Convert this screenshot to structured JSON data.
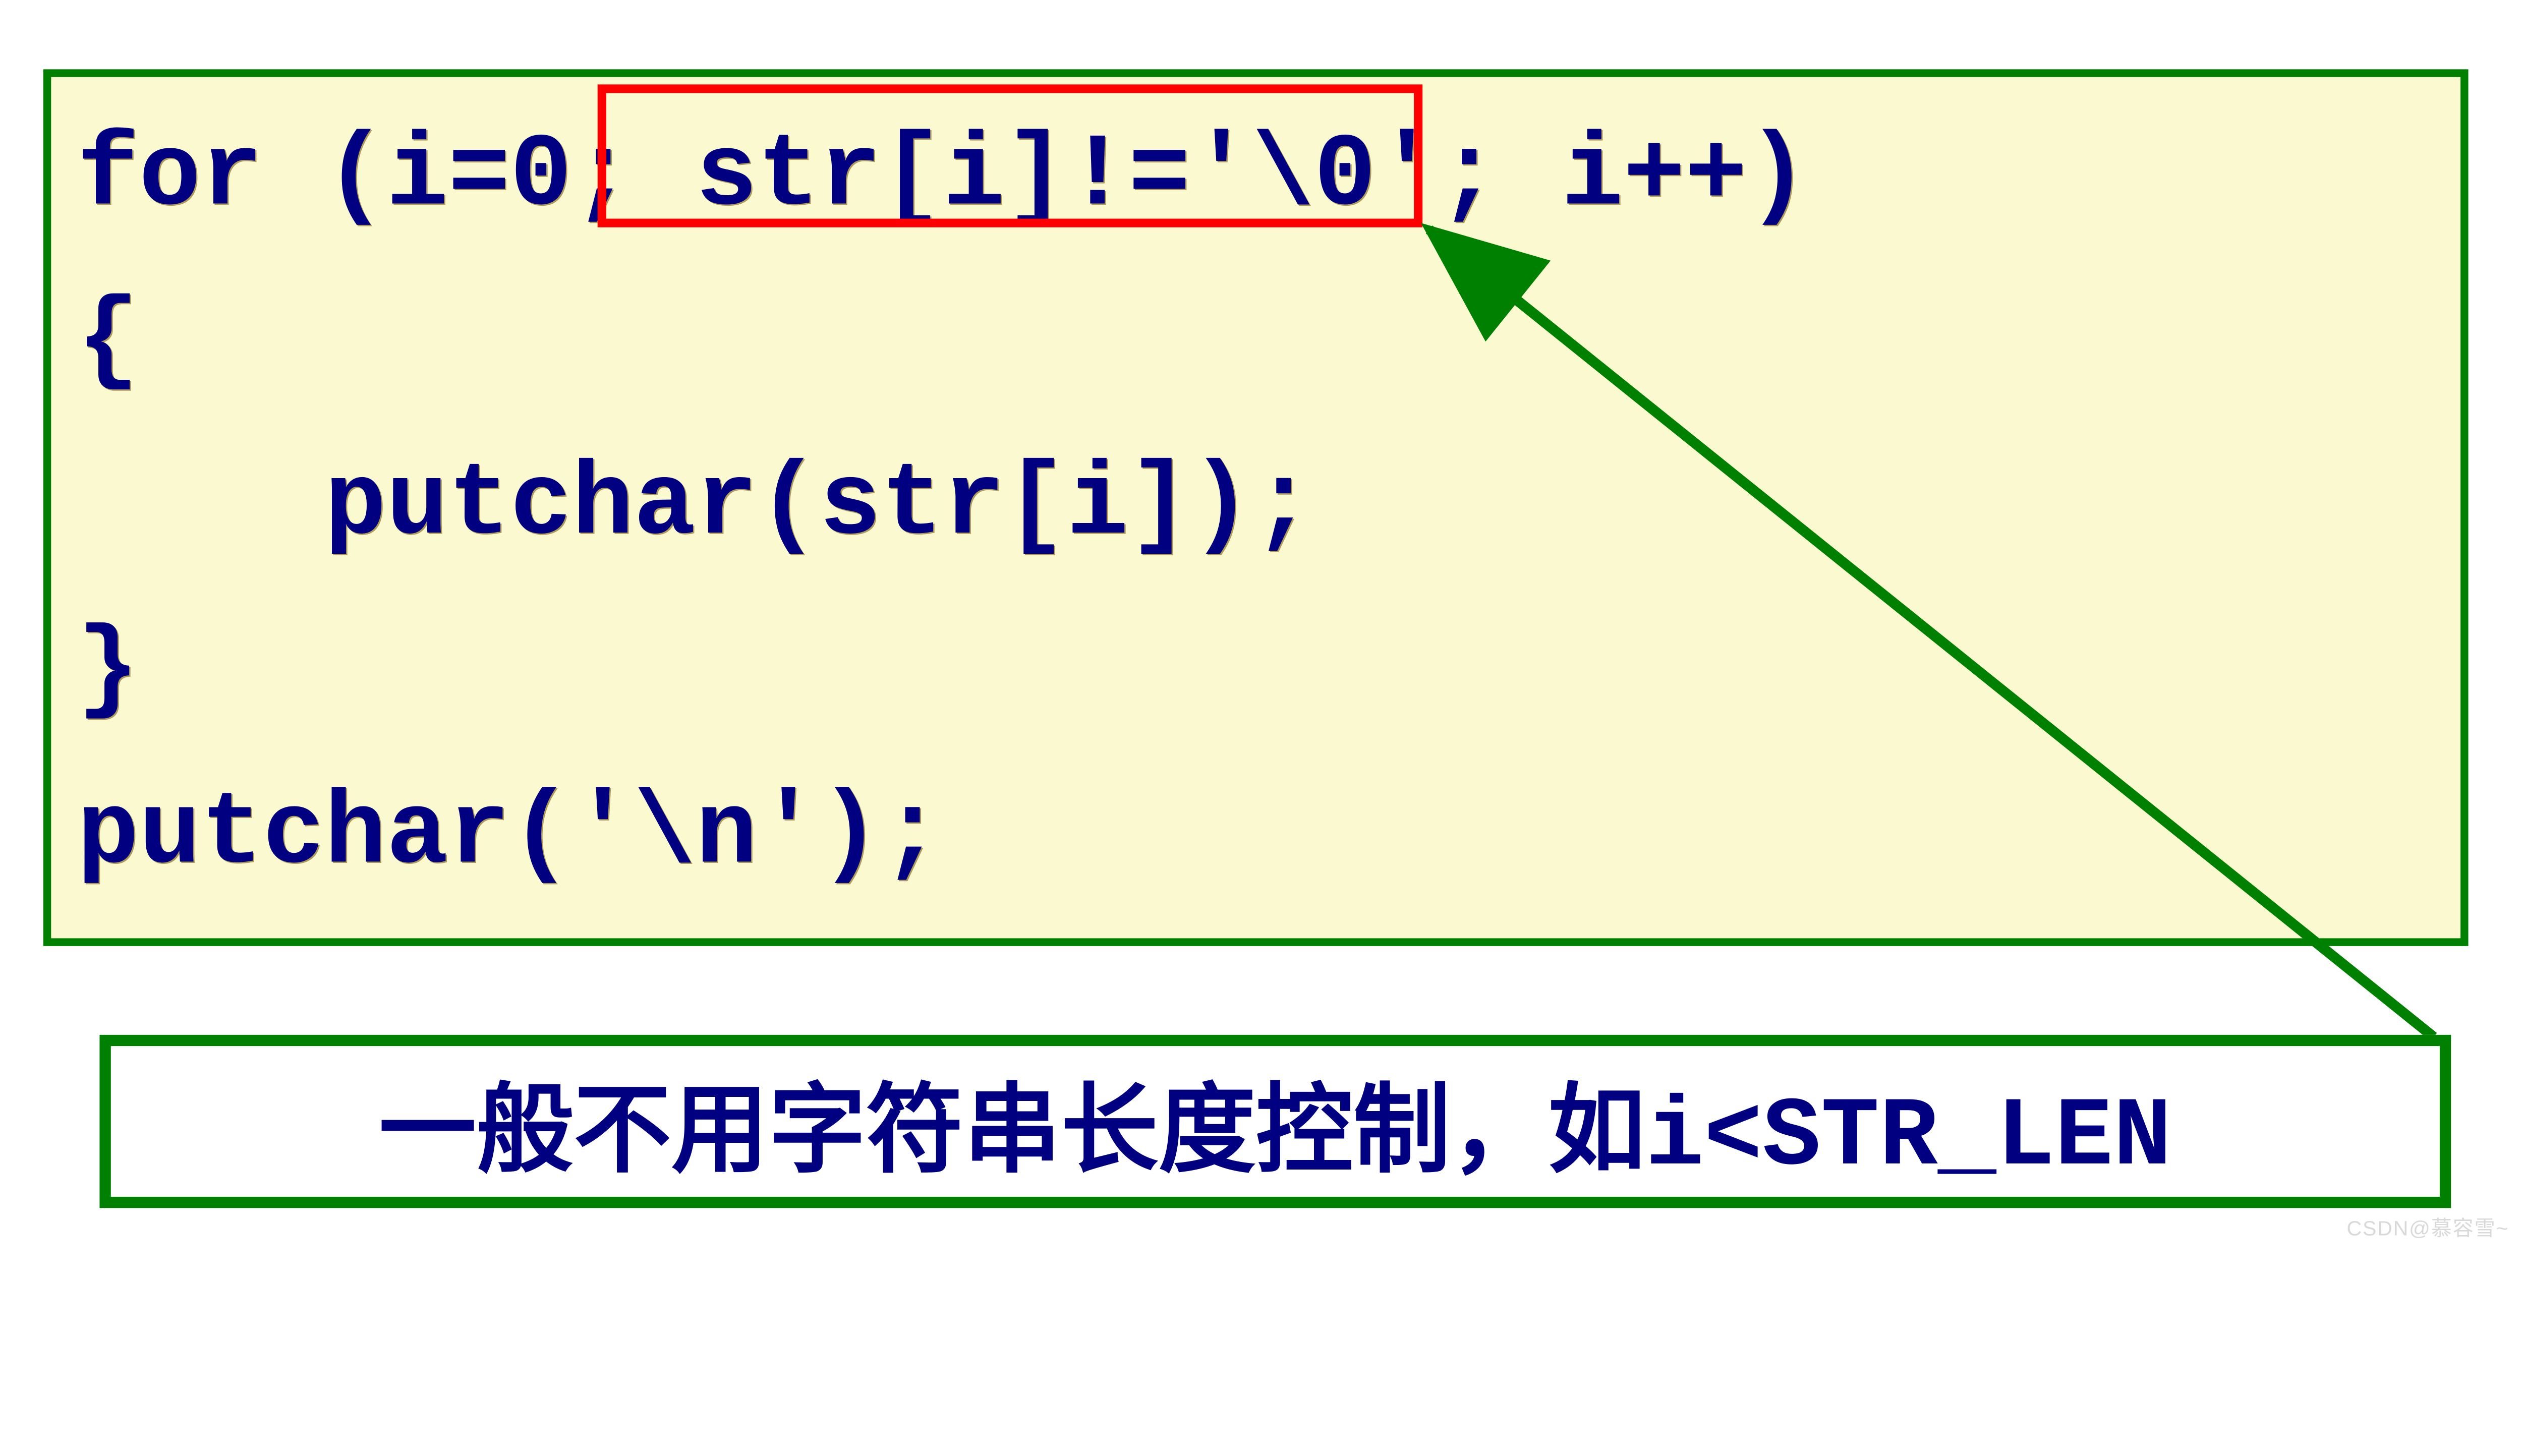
{
  "code": {
    "line1_a": "for (i=0; ",
    "line1_b": "str[i]!='\\0'",
    "line1_c": "; i++)",
    "line2": "{",
    "line3": "    putchar(str[i]);",
    "line4": "}",
    "line5": "putchar('\\n');"
  },
  "annotation": {
    "text_cn": "一般不用字符串长度控制，如",
    "text_code": "i<STR_LEN"
  },
  "colors": {
    "box_bg": "#faf9cf",
    "border_green": "#008000",
    "border_red": "#ff0000",
    "text_navy": "#000080"
  },
  "watermark": "CSDN@慕容雪~"
}
